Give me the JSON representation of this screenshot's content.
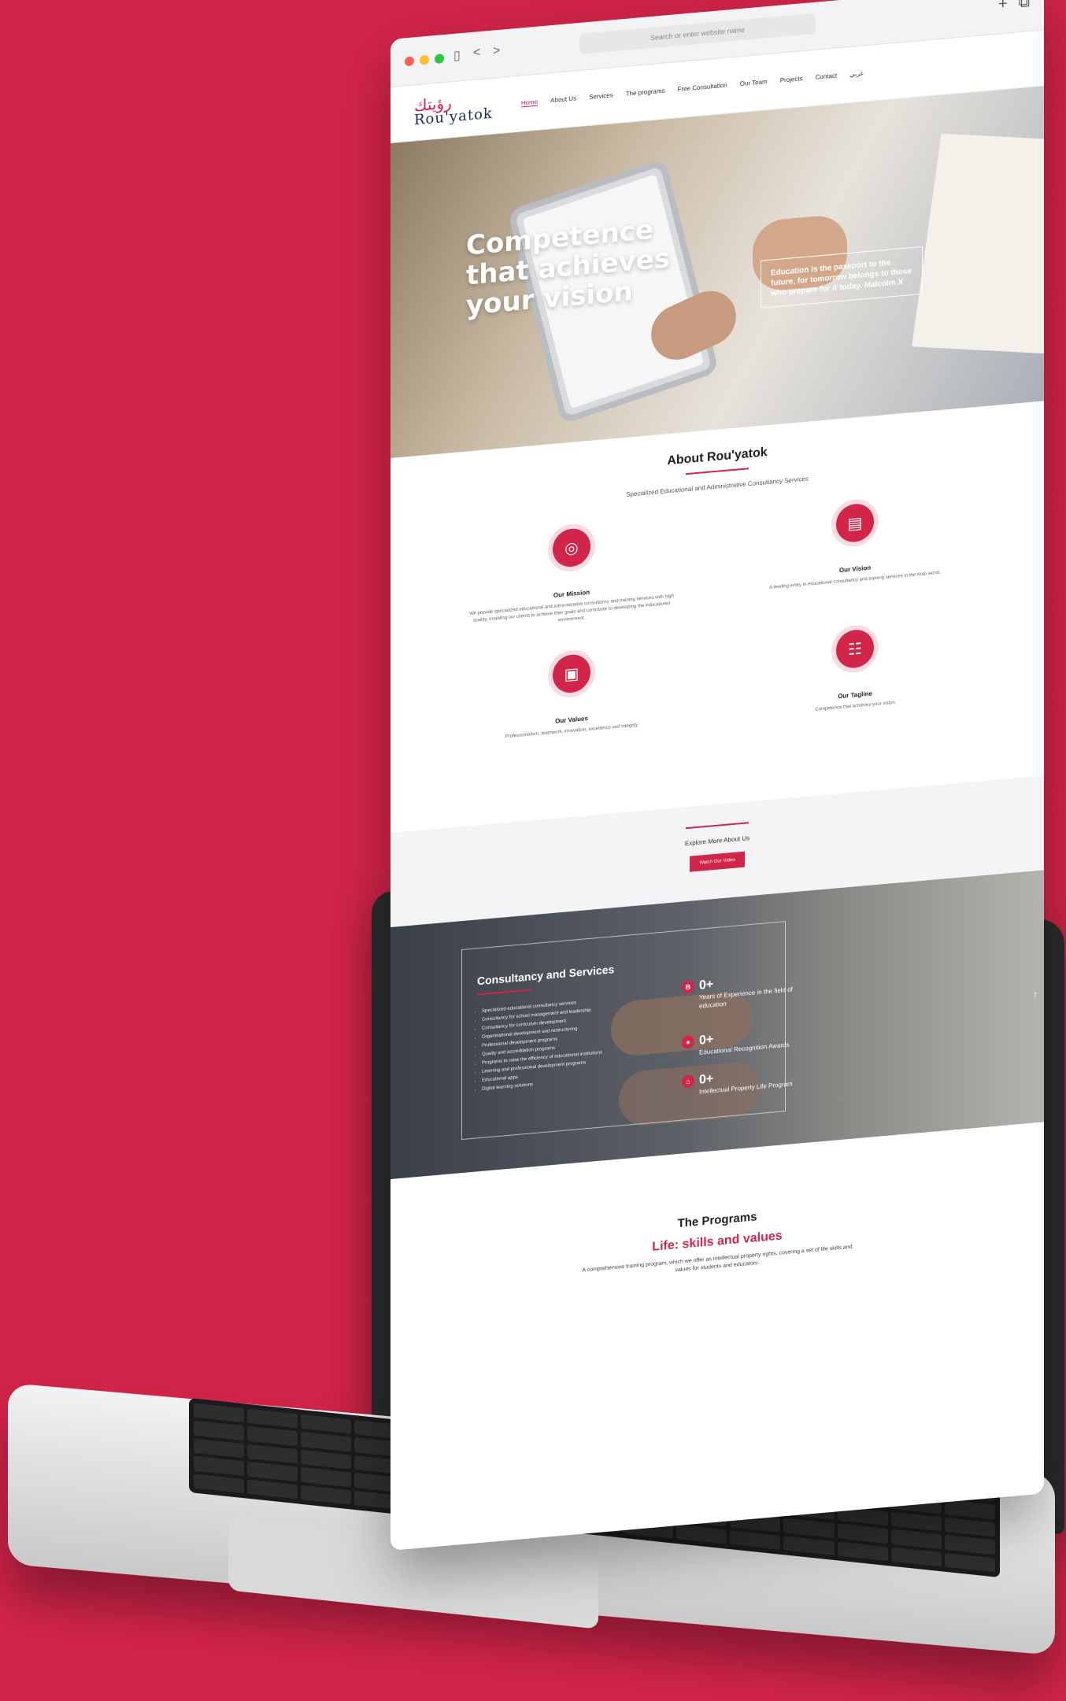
{
  "browser": {
    "address_placeholder": "Search or enter website name",
    "back_icon": "<",
    "forward_icon": ">",
    "plus_icon": "+",
    "copy_icon": "⧉"
  },
  "brand": {
    "logo_arabic": "رؤيتك",
    "logo_latin": "Rou'yatok"
  },
  "nav": [
    "Home",
    "About Us",
    "Services",
    "The programs",
    "Free Consultation",
    "Our Team",
    "Projects",
    "Contact",
    "عربي"
  ],
  "hero": {
    "headline": "Competence that achieves your vision",
    "quote": "Education is the passport to the future, for tomorrow belongs to those who prepare for it today. Malcolm X"
  },
  "about": {
    "title": "About Rou'yatok",
    "subtitle": "Specialized Educational and Administrative Consultancy Services",
    "cards": [
      {
        "title": "Our Mission",
        "text": "We provide specialized educational and administrative consultancy and training services with high quality, enabling our clients to achieve their goals and contribute to developing the educational environment."
      },
      {
        "title": "Our Vision",
        "text": "A leading entity in educational consultancy and training services in the Arab world."
      },
      {
        "title": "Our Values",
        "text": "Professionalism, teamwork, innovation, excellence and integrity"
      },
      {
        "title": "Our Tagline",
        "text": "Competence that achieves your vision"
      }
    ]
  },
  "explore": {
    "label": "Explore More About Us",
    "button": "Watch Our Video"
  },
  "consult": {
    "title": "Consultancy and Services",
    "items": [
      "Specialized educational consultancy services",
      "Consultancy for school management and leadership",
      "Consultancy for curriculum development",
      "Organizational development and restructuring",
      "Professional development programs",
      "Quality and accreditation programs",
      "Programs to raise the efficiency of educational institutions",
      "Learning and professional development programs",
      "Educational apps",
      "Digital learning solutions"
    ],
    "stats": [
      {
        "value": "0+",
        "label": "Years of Experience in the field of education",
        "icon": "B"
      },
      {
        "value": "0+",
        "label": "Educational Recognition Awards",
        "icon": "●"
      },
      {
        "value": "0+",
        "label": "Intellectual Property Life Program",
        "icon": "⌂"
      }
    ],
    "scroll_icon": "↑"
  },
  "programs": {
    "title": "The Programs",
    "subtitle": "Life: skills and values",
    "text": "A comprehensive training program, which we offer as intellectual property rights, covering a set of life skills and values for students and educators."
  }
}
